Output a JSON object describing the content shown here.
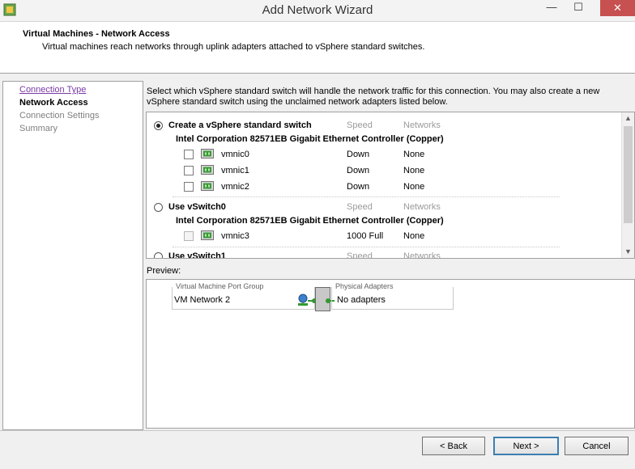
{
  "window": {
    "title": "Add Network Wizard",
    "minimize_glyph": "—",
    "maximize_glyph": "☐",
    "close_glyph": "✕"
  },
  "header": {
    "title": "Virtual Machines - Network Access",
    "subtitle": "Virtual machines reach networks through uplink adapters attached to vSphere standard switches."
  },
  "nav": {
    "items": [
      {
        "label": "Connection Type",
        "state": "link"
      },
      {
        "label": "Network Access",
        "state": "current"
      },
      {
        "label": "Connection Settings",
        "state": "disabled"
      },
      {
        "label": "Summary",
        "state": "disabled"
      }
    ]
  },
  "instructions": "Select which vSphere standard switch will handle the network traffic for this connection. You may also create a new vSphere standard switch using the unclaimed network adapters listed below.",
  "switch_list": {
    "speed_header": "Speed",
    "networks_header": "Networks",
    "options": [
      {
        "label": "Create a vSphere standard switch",
        "selected": true,
        "adapter_name": "Intel Corporation 82571EB Gigabit Ethernet Controller (Copper)",
        "nics": [
          {
            "name": "vmnic0",
            "speed": "Down",
            "networks": "None"
          },
          {
            "name": "vmnic1",
            "speed": "Down",
            "networks": "None"
          },
          {
            "name": "vmnic2",
            "speed": "Down",
            "networks": "None"
          }
        ]
      },
      {
        "label": "Use vSwitch0",
        "selected": false,
        "adapter_name": "Intel Corporation 82571EB Gigabit Ethernet Controller (Copper)",
        "nics": [
          {
            "name": "vmnic3",
            "speed": "1000 Full",
            "networks": "None"
          }
        ]
      },
      {
        "label": "Use vSwitch1",
        "selected": false
      }
    ]
  },
  "preview": {
    "label": "Preview:",
    "port_group_legend": "Virtual Machine Port Group",
    "port_group_name": "VM Network 2",
    "physical_adapters_legend": "Physical Adapters",
    "physical_adapters_value": "No adapters"
  },
  "buttons": {
    "back": "< Back",
    "next": "Next >",
    "cancel": "Cancel"
  },
  "colors": {
    "link": "#7a3aa6",
    "connector": "#2f9a2f",
    "close_button": "#c75050"
  }
}
